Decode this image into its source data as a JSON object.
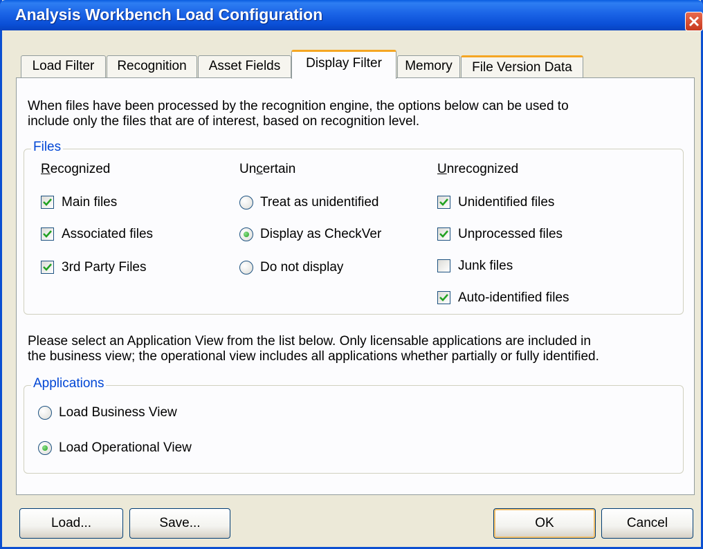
{
  "window": {
    "title": "Analysis Workbench Load Configuration",
    "accent": "#0a5de0",
    "close_icon": "close-icon"
  },
  "tabs": [
    {
      "label": "Load Filter",
      "active": false
    },
    {
      "label": "Recognition",
      "active": false
    },
    {
      "label": "Asset Fields",
      "active": false
    },
    {
      "label": "Display Filter",
      "active": true
    },
    {
      "label": "Memory",
      "active": false
    },
    {
      "label": "File Version Data",
      "active": false
    }
  ],
  "panel": {
    "intro_line1": "When files have been processed by the recognition engine, the options below can be used to",
    "intro_line2": "include only the files that are of interest, based on recognition level.",
    "files_group": {
      "legend": "Files",
      "recognized": {
        "heading_first": "R",
        "heading_rest": "ecognized",
        "options": [
          {
            "label": "Main files",
            "checked": true
          },
          {
            "label": "Associated files",
            "checked": true
          },
          {
            "label": "3rd Party Files",
            "checked": true
          }
        ]
      },
      "uncertain": {
        "heading_pre": "Un",
        "heading_ul": "c",
        "heading_post": "ertain",
        "options": [
          {
            "label": "Treat as unidentified",
            "selected": false
          },
          {
            "label": "Display as CheckVer",
            "selected": true
          },
          {
            "label": "Do not display",
            "selected": false
          }
        ]
      },
      "unrecognized": {
        "heading_first": "U",
        "heading_rest": "nrecognized",
        "options": [
          {
            "label": "Unidentified files",
            "checked": true
          },
          {
            "label": "Unprocessed files",
            "checked": true
          },
          {
            "label": "Junk files",
            "checked": false
          },
          {
            "label": "Auto-identified files",
            "checked": true
          }
        ]
      }
    },
    "app_line1": "Please select an Application View from the list below.  Only licensable applications are included in",
    "app_line2": "the business view; the operational view includes all applications whether partially or fully identified.",
    "apps_group": {
      "legend": "Applications",
      "options": [
        {
          "label": "Load Business View",
          "selected": false
        },
        {
          "label": "Load Operational View",
          "selected": true
        }
      ]
    }
  },
  "buttons": {
    "load": "Load...",
    "save": "Save...",
    "ok": "OK",
    "cancel": "Cancel"
  }
}
